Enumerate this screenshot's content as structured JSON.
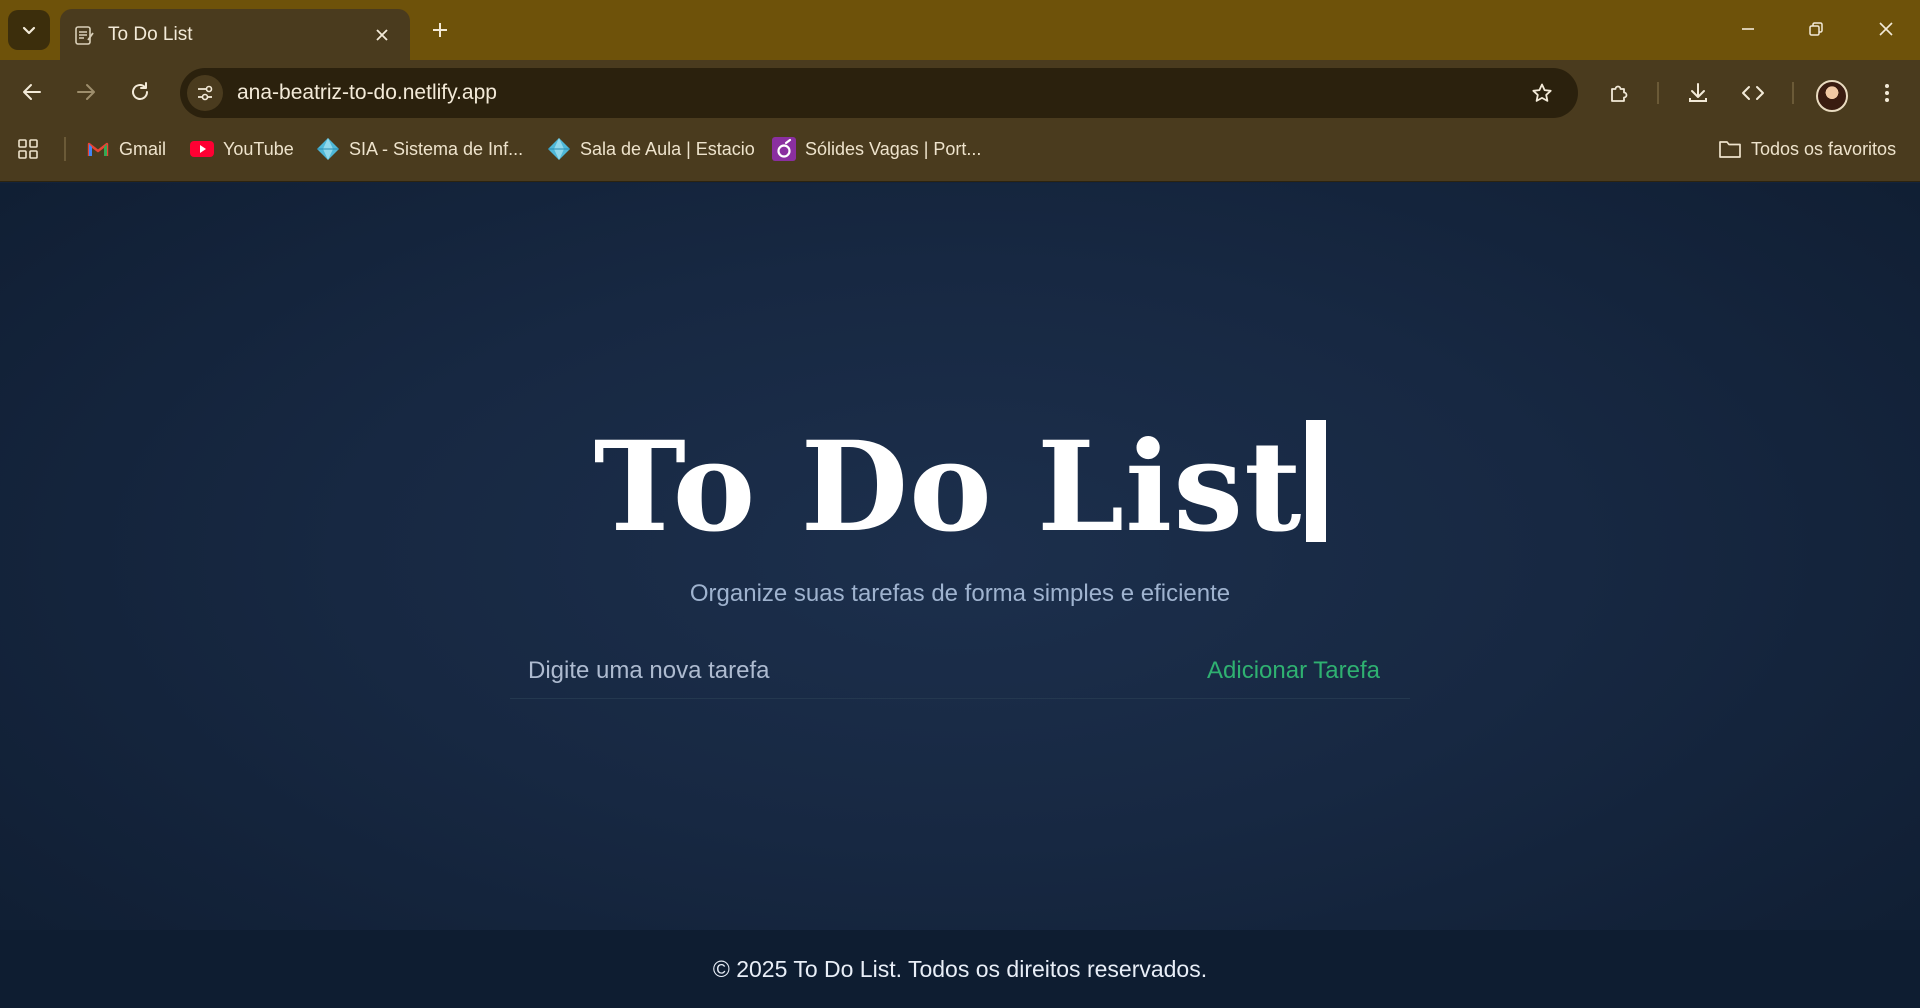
{
  "browser": {
    "tab": {
      "title": "To Do List"
    },
    "url": "ana-beatriz-to-do.netlify.app",
    "bookmarks": [
      {
        "label": "Gmail",
        "icon": "gmail-icon"
      },
      {
        "label": "YouTube",
        "icon": "youtube-icon"
      },
      {
        "label": "SIA - Sistema de Inf...",
        "icon": "diamond-icon"
      },
      {
        "label": "Sala de Aula | Estacio",
        "icon": "diamond-icon"
      },
      {
        "label": "Sólides Vagas | Port...",
        "icon": "solides-icon"
      }
    ],
    "all_bookmarks": "Todos os favoritos",
    "colors": {
      "frame": "#6e520a",
      "toolbar": "#4a3b1e"
    }
  },
  "page": {
    "title": "To Do List",
    "subtitle": "Organize suas tarefas de forma simples e eficiente",
    "input_placeholder": "Digite uma nova tarefa",
    "add_button": "Adicionar Tarefa",
    "footer": "© 2025 To Do List. Todos os direitos reservados.",
    "colors": {
      "background": "#13233a",
      "accent": "#2fb171"
    }
  }
}
